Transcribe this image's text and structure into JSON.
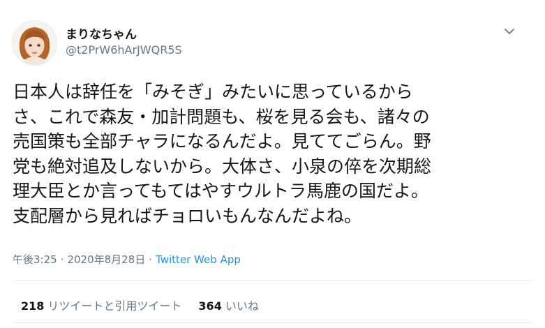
{
  "user": {
    "display_name": "まりなちゃん",
    "handle": "@t2PrW6hArJWQR5S"
  },
  "tweet": {
    "text": "日本人は辞任を「みそぎ」みたいに思っているから\nさ、これで森友・加計問題も、桜を見る会も、諸々の\n売国策も全部チャラになるんだよ。見ててごらん。野\n党も絶対追及しないから。大体さ、小泉の倅を次期総\n理大臣とか言ってもてはやすウルトラ馬鹿の国だよ。\n支配層から見ればチョロいもんなんだよね。",
    "time": "午後3:25",
    "separator": "·",
    "date": "2020年8月28日",
    "source": "Twitter Web App"
  },
  "stats": {
    "retweets_count": "218",
    "retweets_label": "リツイートと引用ツイート",
    "likes_count": "364",
    "likes_label": "いいね"
  },
  "icons": {
    "menu": "chevron-down-icon",
    "avatar": "avatar-illustration"
  },
  "colors": {
    "text": "#14171a",
    "secondary": "#657786",
    "link": "#1b95e0",
    "divider": "#e6ecf0"
  }
}
